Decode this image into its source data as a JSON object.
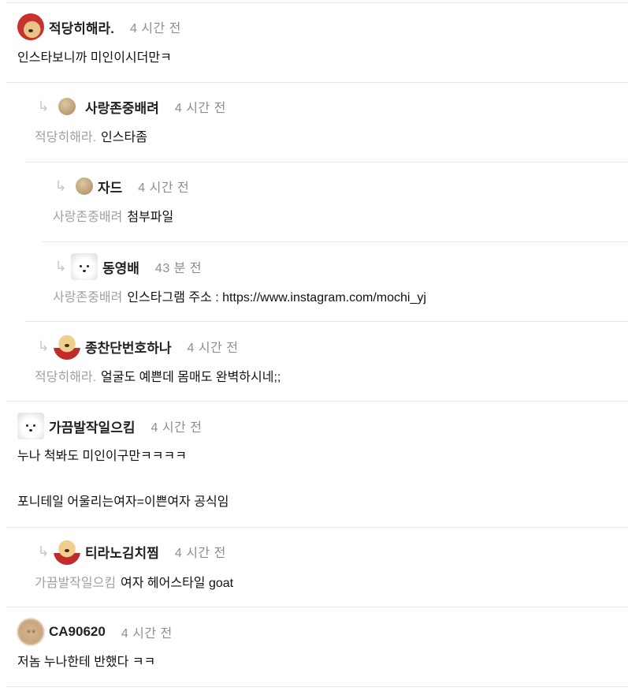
{
  "comments": [
    {
      "nickname": "적당히해라.",
      "time": "4 시간 전",
      "text": "인스타보니까 미인이시더만ㅋ"
    },
    {
      "nickname": "사랑존중배려",
      "time": "4 시간 전",
      "mention": "적당히해라.",
      "text": "인스타좀"
    },
    {
      "nickname": "자드",
      "time": "4 시간 전",
      "mention": "사랑존중배려",
      "text": "첨부파일"
    },
    {
      "nickname": "동영배",
      "time": "43 분 전",
      "mention": "사랑존중배려",
      "text": "인스타그램 주소 : https://www.instagram.com/mochi_yj"
    },
    {
      "nickname": "종찬단번호하나",
      "time": "4 시간 전",
      "mention": "적당히해라.",
      "text": "얼굴도 예쁜데 몸매도 완벽하시네;;"
    },
    {
      "nickname": "가끔발작일으킴",
      "time": "4 시간 전",
      "text_line1": "누나 척봐도 미인이구만ㅋㅋㅋㅋ",
      "text_line2": "포니테일 어울리는여자=이쁜여자 공식임"
    },
    {
      "nickname": "티라노김치찜",
      "time": "4 시간 전",
      "mention": "가끔발작일으킴",
      "text": "여자 헤어스타일 goat"
    },
    {
      "nickname": "CA90620",
      "time": "4 시간 전",
      "text": "저놈 누나한테 반했다 ㅋㅋ"
    }
  ],
  "icons": {
    "reply": "reply-arrow-icon"
  }
}
